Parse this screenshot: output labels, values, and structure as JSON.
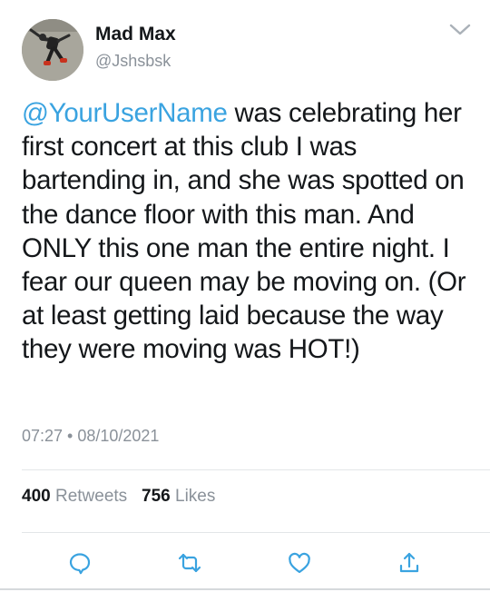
{
  "author": {
    "name": "Mad Max",
    "handle": "@Jshsbsk"
  },
  "tweet": {
    "mention": "@YourUserName",
    "body": " was celebrating her first concert at this club I was bartending in, and she was spotted on the dance floor with this man. And ONLY this one man the entire night. I fear our queen may be moving on. (Or at least getting laid because the way they were moving was HOT!)",
    "timestamp": "07:27 • 08/10/2021"
  },
  "stats": {
    "retweets_count": "400",
    "retweets_label": "Retweets",
    "likes_count": "756",
    "likes_label": "Likes"
  },
  "icons": {
    "menu": "chevron-down-icon",
    "reply": "reply-icon",
    "retweet": "retweet-icon",
    "like": "heart-icon",
    "share": "share-icon"
  },
  "colors": {
    "accent": "#3aa3e0",
    "muted": "#8a9199",
    "text": "#14171a"
  }
}
